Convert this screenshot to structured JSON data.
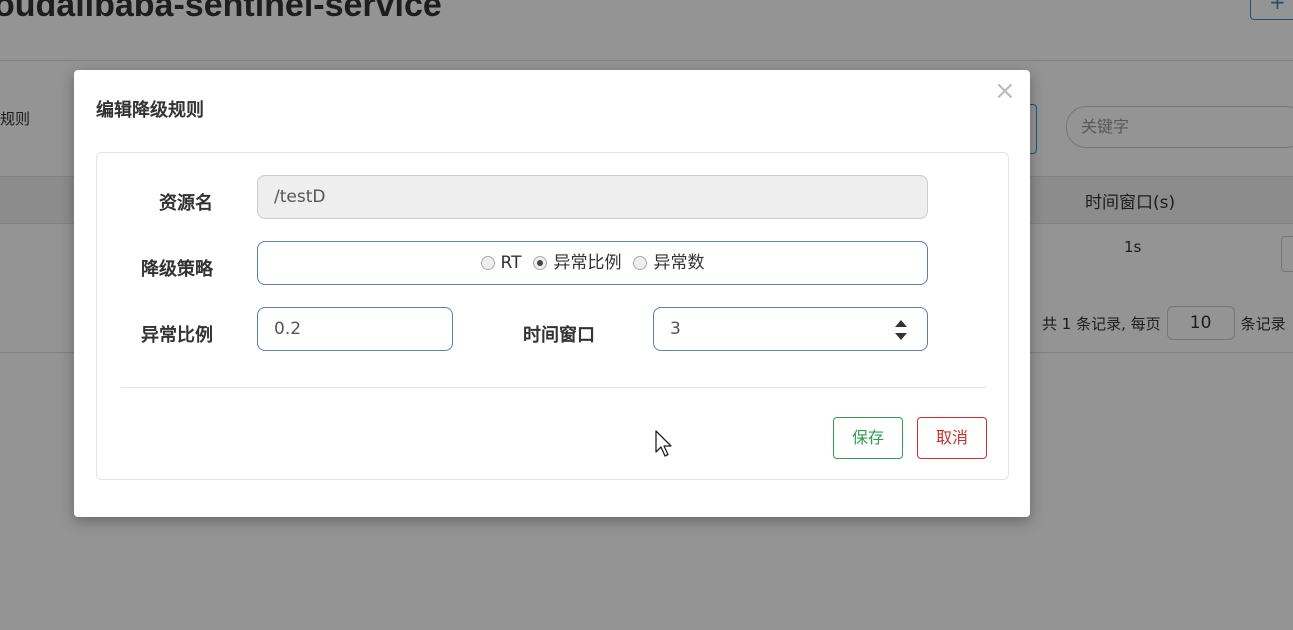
{
  "background": {
    "page_title": "oudalibaba-sentinel-service",
    "add_button_label": "+",
    "rules_label": "规则",
    "search_placeholder": "关键字",
    "table_header_time_window": "时间窗口(s)",
    "table_cell_time_window": "1s",
    "pager": {
      "prefix": "共 1 条记录, 每页",
      "page_size": "10",
      "suffix": "条记录"
    }
  },
  "modal": {
    "title": "编辑降级规则",
    "close_icon": "×",
    "fields": {
      "resource": {
        "label": "资源名",
        "value": "/testD"
      },
      "strategy": {
        "label": "降级策略",
        "options": [
          "RT",
          "异常比例",
          "异常数"
        ],
        "selected": "异常比例"
      },
      "ratio": {
        "label": "异常比例",
        "value": "0.2"
      },
      "time_window": {
        "label": "时间窗口",
        "value": "3"
      }
    },
    "buttons": {
      "save": "保存",
      "cancel": "取消"
    }
  },
  "colors": {
    "save": "#2e9e4f",
    "cancel": "#c9302c",
    "input_border": "#5b7fa6"
  }
}
